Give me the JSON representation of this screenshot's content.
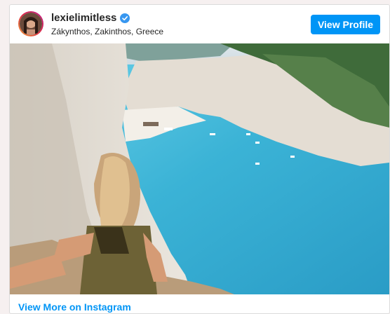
{
  "post": {
    "username": "lexielimitless",
    "location": "Zákynthos, Zakinthos, Greece",
    "view_profile_label": "View Profile",
    "footer_link": "View More on Instagram"
  },
  "icons": {
    "verified": "verified-badge-icon"
  },
  "colors": {
    "accent": "#0095f6",
    "page_bg": "#f6f0f0"
  }
}
